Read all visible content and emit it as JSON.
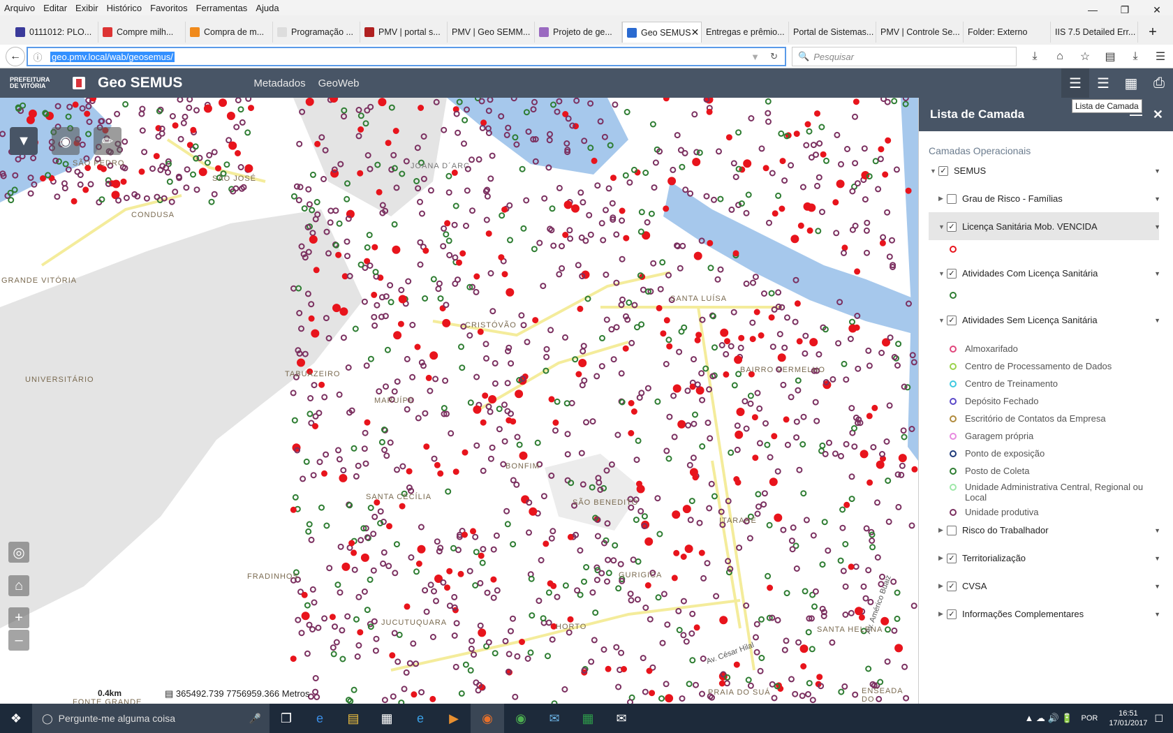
{
  "browser": {
    "menu": [
      "Arquivo",
      "Editar",
      "Exibir",
      "Histórico",
      "Favoritos",
      "Ferramentas",
      "Ajuda"
    ],
    "tabs": [
      "0111012: PLO...",
      "Compre milh...",
      "Compra de m...",
      "Programação ...",
      "PMV | portal s...",
      "PMV | Geo SEMM...",
      "Projeto de ge...",
      "Geo SEMUS",
      "Entregas e prêmio...",
      "Portal de Sistemas...",
      "PMV | Controle Se...",
      "Folder: Externo",
      "IIS 7.5 Detailed Err..."
    ],
    "active_tab": "Geo SEMUS",
    "url": "geo.pmv.local/wab/geosemus/",
    "search_placeholder": "Pesquisar"
  },
  "app": {
    "logo": "PREFEITURA DE VITÓRIA",
    "title": "Geo SEMUS",
    "links": [
      "Metadados",
      "GeoWeb"
    ],
    "tooltip": "Lista de Camada"
  },
  "map": {
    "labels": [
      "SÃO PEDRO",
      "SÃO JOSÉ",
      "CONDUSA",
      "JOANA D´ARC",
      "GRANDE VITÓRIA",
      "UNIVERSITÁRIO",
      "TABUAZEIRO",
      "CRISTÓVÃO",
      "SANTA LUÍSA",
      "BAIRRO VERMELHO",
      "SANTA CECÍLIA",
      "SÃO BENEDITO",
      "FRADINHOS",
      "GURIGICA",
      "HORTO",
      "SANTA HELENA",
      "ENSEADA DO",
      "FONTE GRANDE",
      "JUCUTUQUARA",
      "ITARARÉ",
      "BONFIM",
      "MARUÍPE",
      "PRAIA DO SUÁ",
      "Av. César Hilal",
      "Av. Américo Buaiz"
    ],
    "scale": "0.4km",
    "coords": "365492.739  7756959.366 Metros"
  },
  "panel": {
    "title": "Lista de Camada",
    "section": "Camadas Operacionais",
    "root": "SEMUS",
    "layers": [
      {
        "label": "Grau de Risco - Famílias",
        "checked": false
      },
      {
        "label": "Licença Sanitária Mob. VENCIDA",
        "checked": true
      },
      {
        "label": "Atividades Com Licença Sanitária",
        "checked": true
      },
      {
        "label": "Atividades Sem Licença Sanitária",
        "checked": true
      },
      {
        "label": "Risco do Trabalhador",
        "checked": false
      },
      {
        "label": "Territorialização",
        "checked": true
      },
      {
        "label": "CVSA",
        "checked": true
      },
      {
        "label": "Informações Complementares",
        "checked": true
      }
    ],
    "legend": [
      {
        "label": "Almoxarifado",
        "color": "#e0457b"
      },
      {
        "label": "Centro de Processamento de Dados",
        "color": "#9bd24b"
      },
      {
        "label": "Centro de Treinamento",
        "color": "#3ec9e0"
      },
      {
        "label": "Depósito Fechado",
        "color": "#5a48c8"
      },
      {
        "label": "Escritório de Contatos da Empresa",
        "color": "#b08a3c"
      },
      {
        "label": "Garagem própria",
        "color": "#e889e0"
      },
      {
        "label": "Ponto de exposição",
        "color": "#1e3a7a"
      },
      {
        "label": "Posto de Coleta",
        "color": "#2e7d32"
      },
      {
        "label": "Unidade Administrativa Central, Regional ou Local",
        "color": "#9ee8a8"
      },
      {
        "label": "Unidade produtiva",
        "color": "#7b3060"
      }
    ]
  },
  "taskbar": {
    "search": "Pergunte-me alguma coisa",
    "lang": "POR",
    "time": "16:51",
    "date": "17/01/2017"
  },
  "colors": {
    "appbar": "#485566",
    "expired": "#e8141c",
    "licensed": "#2e7d32",
    "unlicensed": "#7b3060"
  }
}
